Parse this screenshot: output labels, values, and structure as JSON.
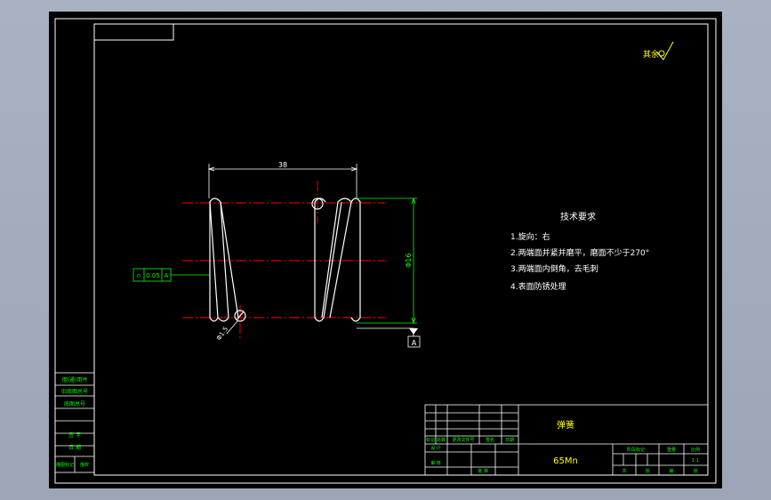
{
  "drawing": {
    "roughness_note": "其余",
    "dimensions": {
      "length": "38",
      "diameter": "Φ16",
      "wire": "Φ1.5"
    },
    "datum": "A",
    "tolerance_frame": [
      "⌭",
      "0.05",
      "A"
    ],
    "tech_req": {
      "title": "技术要求",
      "items": [
        "1.旋向：右",
        "2.两端面并紧并磨平，磨面不少于270°",
        "3.两端面内倒角，去毛刺",
        "4.表面防锈处理"
      ]
    }
  },
  "title_block": {
    "part_name": "弹簧",
    "material": "65Mn",
    "header_labels": [
      "标记",
      "处数",
      "更改文件号",
      "签名",
      "日期"
    ],
    "row_labels": [
      "设 计",
      "审 核"
    ],
    "approve_label": "批 准",
    "stage_labels": [
      "阶段标记",
      "重量",
      "比例"
    ],
    "scale": "1:1",
    "sheet_labels": [
      "共",
      "张",
      "第",
      "张"
    ]
  },
  "side_table": {
    "items": [
      "借(通)用件",
      "旧底图总号",
      "底图总号",
      "签 字",
      "日 期",
      "描图标记",
      "描校"
    ]
  },
  "colors": {
    "line": "#ffffff",
    "center": "#ff0000",
    "dim": "#00ff00",
    "text": "#ffffff",
    "green_text": "#00ff00",
    "yellow_text": "#ffff00"
  }
}
